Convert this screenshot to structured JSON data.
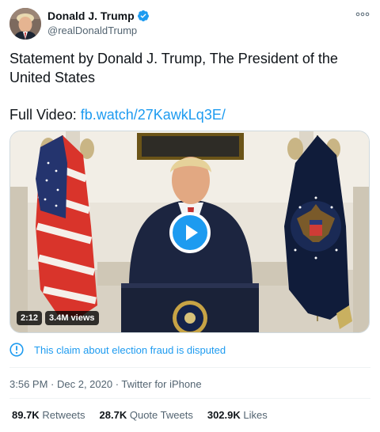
{
  "author": {
    "display_name": "Donald J. Trump",
    "handle": "@realDonaldTrump",
    "verified": true,
    "avatar_icon": "profile-photo"
  },
  "more_icon": "ellipsis-icon",
  "tweet": {
    "line1": "Statement by Donald J. Trump, The President of the United States",
    "video_prefix": "Full Video: ",
    "video_link": "fb.watch/27KawkLq3E/"
  },
  "media": {
    "duration": "2:12",
    "views": "3.4M views",
    "play_icon": "play-icon"
  },
  "notice": {
    "icon": "info-icon",
    "text": "This claim about election fraud is disputed"
  },
  "meta": {
    "time": "3:56 PM",
    "separator1": " · ",
    "date": "Dec 2, 2020",
    "separator2": " · ",
    "source": "Twitter for iPhone"
  },
  "stats": {
    "retweets_count": "89.7K",
    "retweets_label": "Retweets",
    "quotes_count": "28.7K",
    "quotes_label": "Quote Tweets",
    "likes_count": "302.9K",
    "likes_label": "Likes"
  },
  "colors": {
    "accent": "#1d9bf0",
    "text": "#0f1419",
    "secondary": "#536471"
  }
}
